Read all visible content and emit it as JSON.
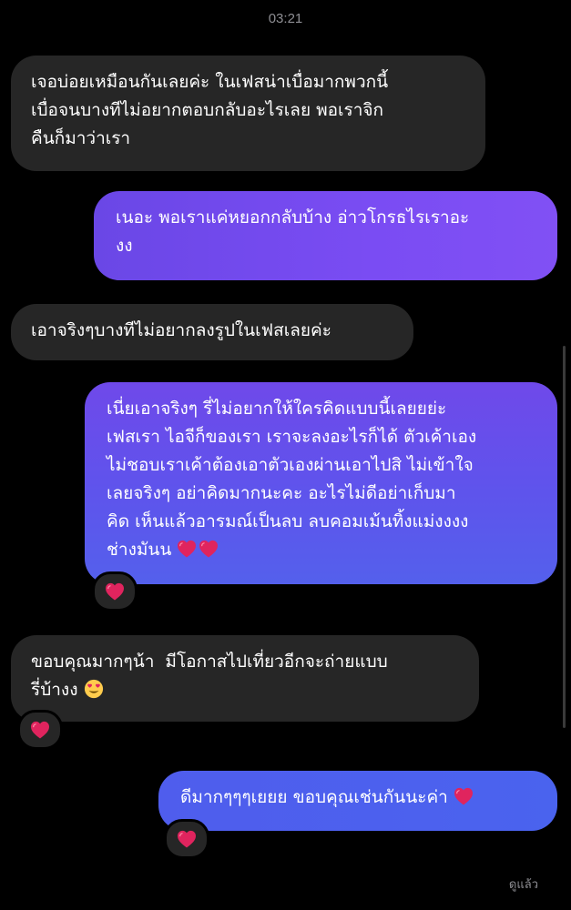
{
  "header": {
    "timestamp": "03:21"
  },
  "messages": [
    {
      "direction": "incoming",
      "text": "เจอบ่อยเหมือนกันเลยค่ะ ในเฟสน่าเบื่อมากพวกนี้\nเบื่อจนบางทีไม่อยากตอบกลับอะไรเลย พอเราจิก\nคืนก็มาว่าเรา"
    },
    {
      "direction": "outgoing",
      "text": "เนอะ พอเราแค่หยอกกลับบ้าง อ่าวโกรธไรเราอะ\nงง"
    },
    {
      "direction": "incoming",
      "text": "เอาจริงๆบางทีไม่อยากลงรูปในเฟสเลยค่ะ"
    },
    {
      "direction": "outgoing",
      "text": "เนี่ยเอาจริงๆ รี่ไม่อยากให้ใครคิดแบบนี้เลยยย่ะ\nเฟสเรา ไอจีก็ของเรา เราจะลงอะไรก็ได้ ตัวเค้าเอง\nไม่ชอบเราเค้าต้องเอาตัวเองผ่านเอาไปสิ ไม่เข้าใจ\nเลยจริงๆ อย่าคิดมากนะคะ อะไรไม่ดีอย่าเก็บมา\nคิด เห็นแล้วอารมณ์เป็นลบ ลบคอมเม้นทิ้งแม่งงงง\nช่างมันน",
      "emoji": "❤️❤️",
      "reaction": "❤️"
    },
    {
      "direction": "incoming",
      "text": "ขอบคุณมากๆน้า  มีโอกาสไปเที่ยวอีกจะถ่ายแบบ\nรี่บ้างง",
      "emoji": "😍",
      "reaction": "❤️"
    },
    {
      "direction": "outgoing",
      "text": "ดีมากๆๆๆเยยย ขอบคุณเช่นกันนะค่า",
      "emoji": "❤️",
      "reaction": "❤️"
    }
  ],
  "footer": {
    "seen_label": "ดูแล้ว"
  },
  "colors": {
    "background": "#000000",
    "incoming_bubble": "#262626",
    "outgoing_top": "#7a4cf3",
    "outgoing_bottom": "#4a63ee",
    "heart": "#e0245e",
    "muted_text": "#8e8e93"
  },
  "icons": {
    "heart": "heart-icon",
    "heart_eyes": "heart-eyes-emoji-icon"
  }
}
